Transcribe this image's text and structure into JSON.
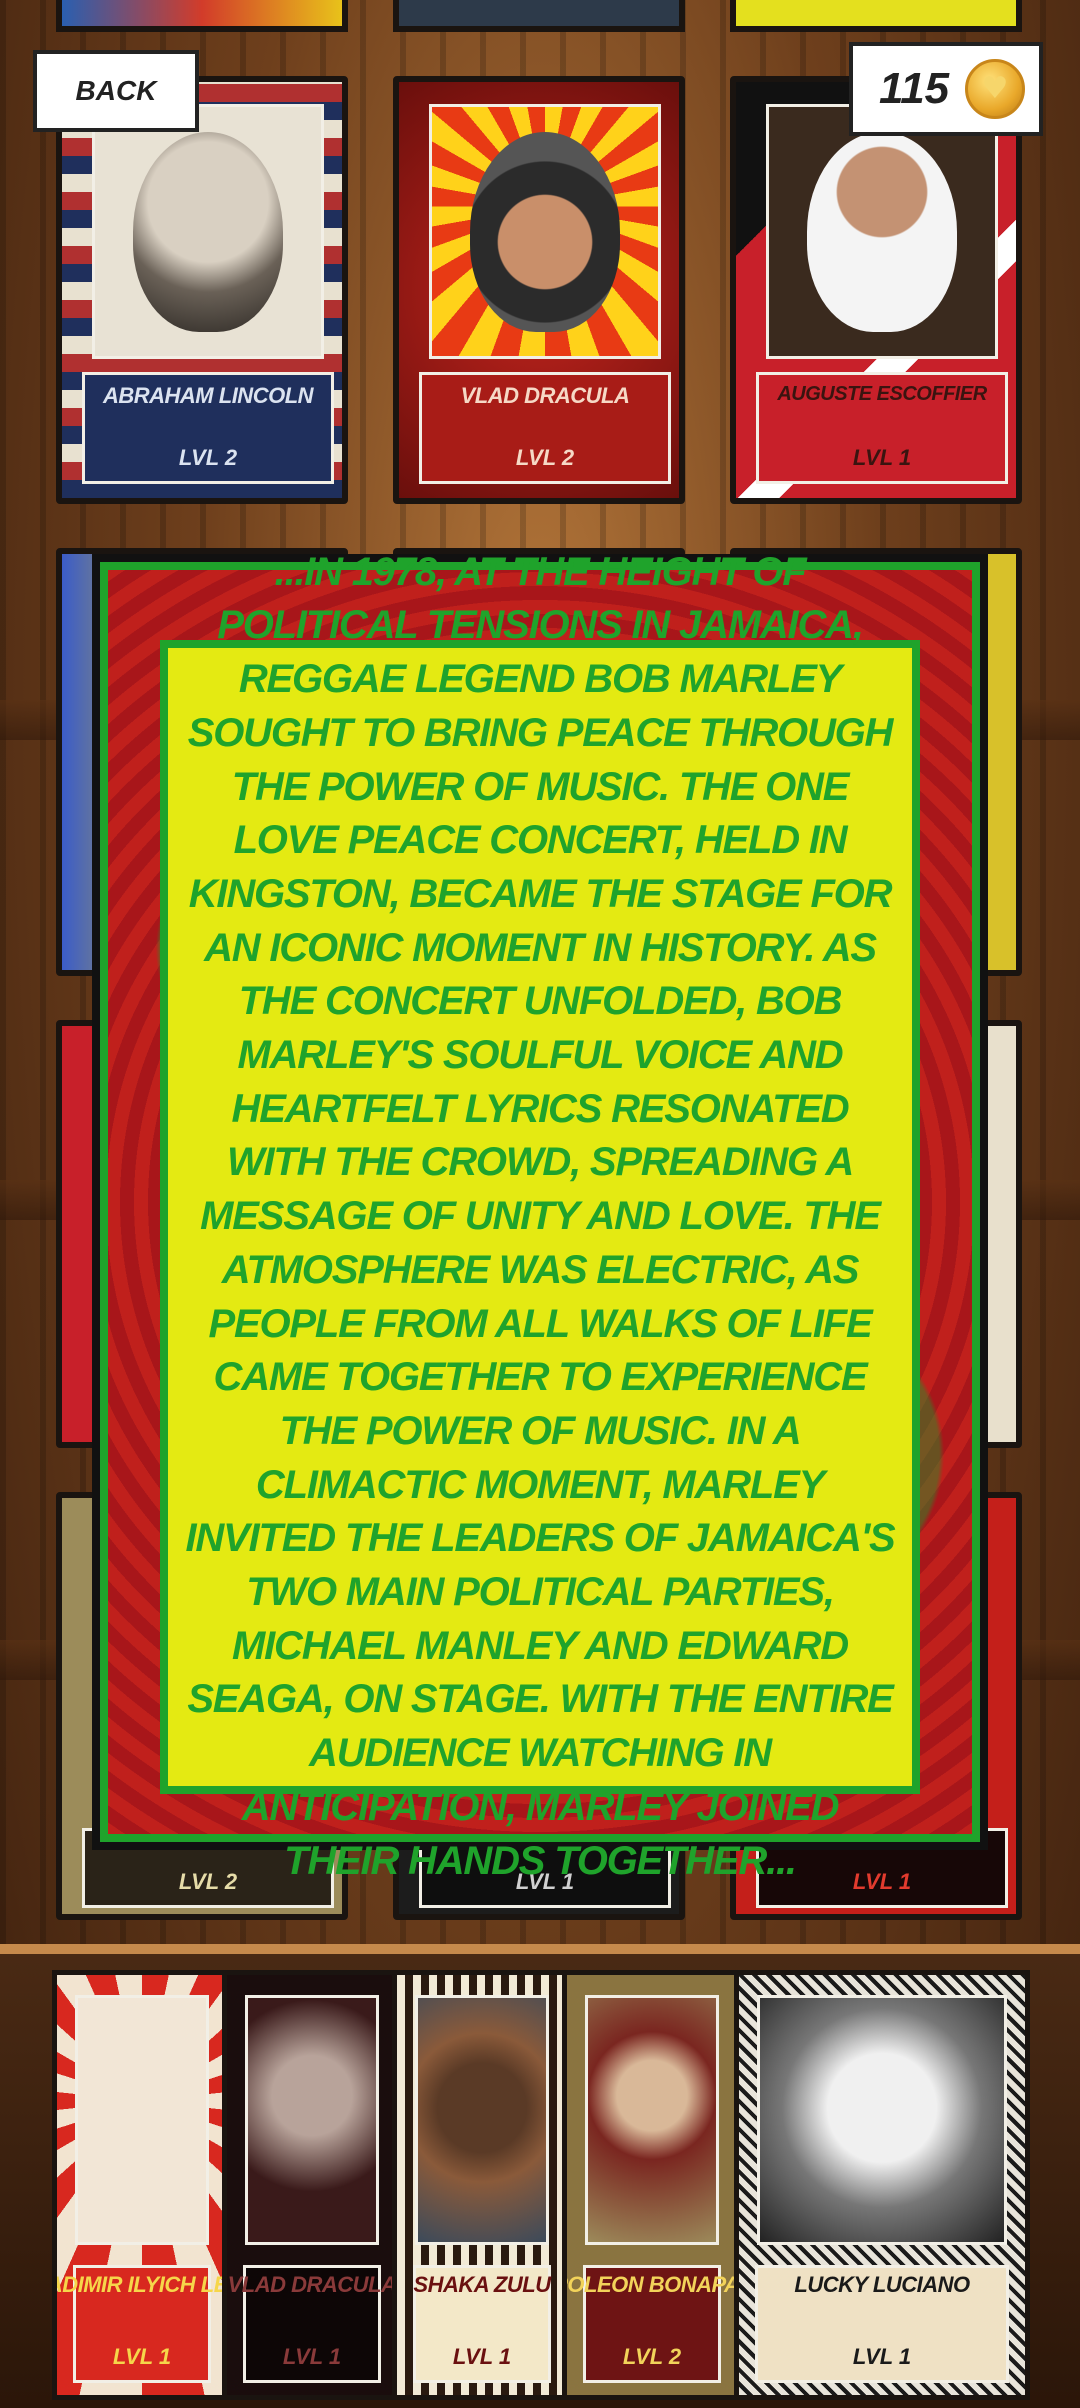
{
  "header": {
    "back_label": "BACK",
    "coin_count": "115",
    "coin_icon": "heart-coin-icon"
  },
  "grid": {
    "row1": [
      {
        "name": "ABRAHAM LINCOLN",
        "level": "LVL 2"
      },
      {
        "name": "VLAD DRACULA",
        "level": "LVL 2"
      },
      {
        "name": "AUGUSTE ESCOFFIER",
        "level": "LVL 1"
      }
    ],
    "row4": [
      {
        "level": "LVL 2"
      },
      {
        "level": "LVL 1"
      },
      {
        "level": "LVL 1"
      }
    ]
  },
  "story": {
    "text": "...IN 1978, AT THE HEIGHT OF POLITICAL TENSIONS IN JAMAICA, REGGAE LEGEND BOB MARLEY SOUGHT TO BRING PEACE THROUGH THE POWER OF MUSIC. THE ONE LOVE PEACE CONCERT, HELD IN KINGSTON, BECAME THE STAGE FOR AN ICONIC MOMENT IN HISTORY. AS THE CONCERT UNFOLDED, BOB MARLEY'S SOULFUL VOICE AND HEARTFELT LYRICS RESONATED WITH THE CROWD, SPREADING A MESSAGE OF UNITY AND LOVE. THE ATMOSPHERE WAS ELECTRIC, AS PEOPLE FROM ALL WALKS OF LIFE CAME TOGETHER TO EXPERIENCE THE POWER OF MUSIC. IN A CLIMACTIC MOMENT, MARLEY INVITED THE LEADERS OF JAMAICA'S TWO MAIN POLITICAL PARTIES, MICHAEL MANLEY AND EDWARD SEAGA, ON STAGE. WITH THE ENTIRE AUDIENCE WATCHING IN ANTICIPATION, MARLEY JOINED THEIR HANDS TOGETHER..."
  },
  "hand": [
    {
      "name": "VLADIMIR ILYICH LENIN",
      "level": "LVL 1"
    },
    {
      "name": "VLAD DRACULA",
      "level": "LVL 1"
    },
    {
      "name": "SHAKA ZULU",
      "level": "LVL 1"
    },
    {
      "name": "NAPOLEON BONAPARTE",
      "level": "LVL 2"
    },
    {
      "name": "LUCKY LUCIANO",
      "level": "LVL 1"
    }
  ]
}
